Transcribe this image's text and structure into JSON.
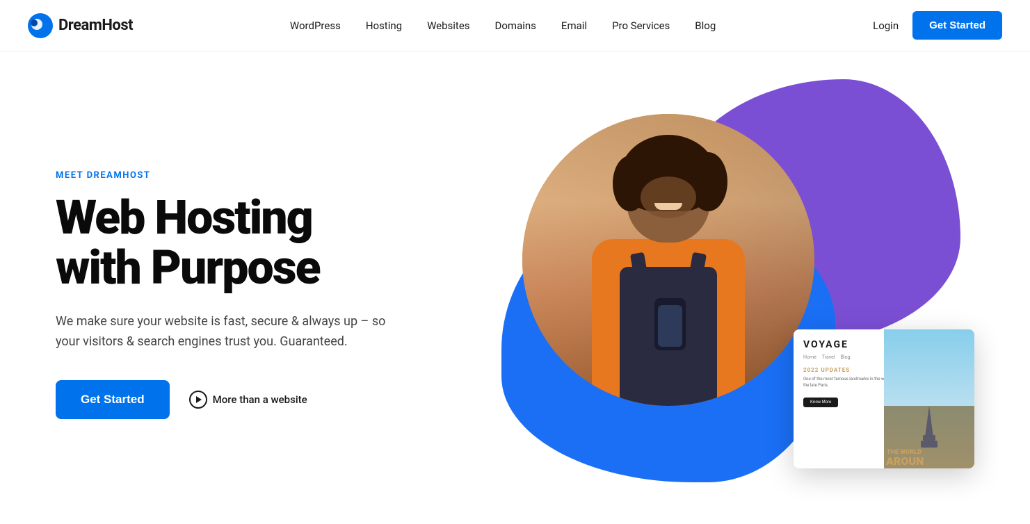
{
  "nav": {
    "logo_text": "DreamHost",
    "links": [
      {
        "label": "WordPress",
        "id": "wordpress"
      },
      {
        "label": "Hosting",
        "id": "hosting"
      },
      {
        "label": "Websites",
        "id": "websites"
      },
      {
        "label": "Domains",
        "id": "domains"
      },
      {
        "label": "Email",
        "id": "email"
      },
      {
        "label": "Pro Services",
        "id": "pro-services"
      },
      {
        "label": "Blog",
        "id": "blog"
      }
    ],
    "login_label": "Login",
    "get_started_label": "Get Started"
  },
  "hero": {
    "eyebrow": "MEET DREAMHOST",
    "title_line1": "Web Hosting",
    "title_line2": "with Purpose",
    "subtitle": "We make sure your website is fast, secure & always up – so your visitors & search engines trust you. Guaranteed.",
    "cta_label": "Get Started",
    "more_label": "More than a website"
  },
  "voyage_card": {
    "title": "VOYAGE",
    "nav_items": [
      "Home",
      "Travel",
      "Blog"
    ],
    "update_label": "2022 UPDATES",
    "update_text": "One of the most famous landmarks in the world, the Eiffel Tower (la Tour Eiffel), by the late Paris.",
    "know_more": "Know More",
    "world_label": "THE WORLD",
    "around_label": "AROUN"
  }
}
